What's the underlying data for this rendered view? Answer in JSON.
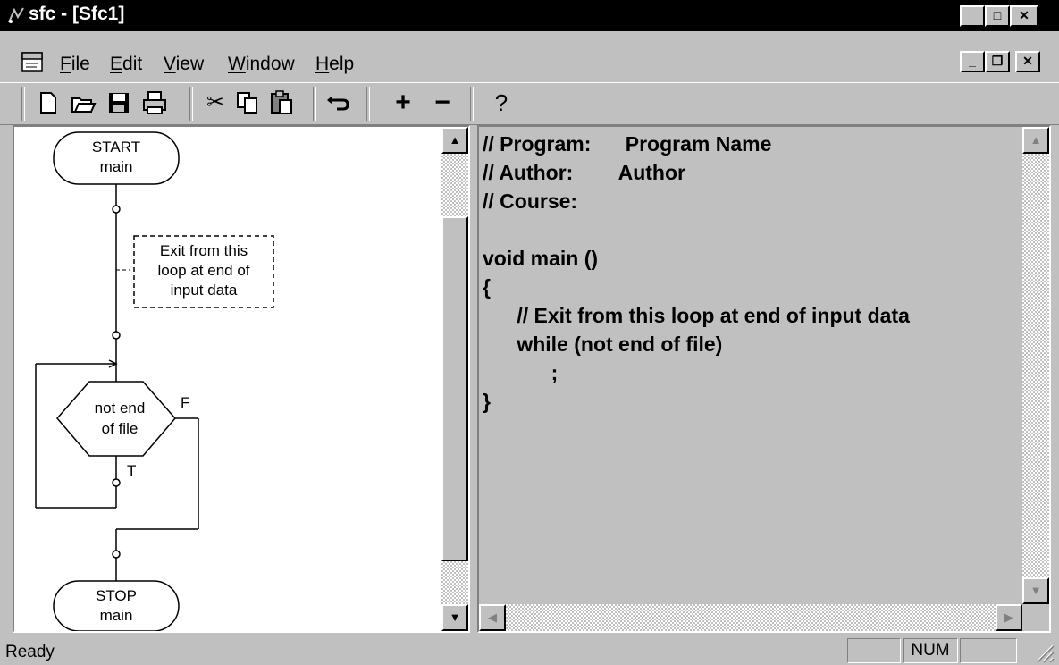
{
  "window": {
    "title": "sfc - [Sfc1]"
  },
  "menu": {
    "items": [
      {
        "label": "File",
        "key": "F",
        "rest": "ile"
      },
      {
        "label": "Edit",
        "key": "E",
        "rest": "dit"
      },
      {
        "label": "View",
        "key": "V",
        "rest": "iew"
      },
      {
        "label": "Window",
        "key": "W",
        "rest": "indow"
      },
      {
        "label": "Help",
        "key": "H",
        "rest": "elp"
      }
    ]
  },
  "toolbar": {
    "icons": [
      "new-file-icon",
      "open-folder-icon",
      "save-icon",
      "print-icon",
      "cut-icon",
      "copy-icon",
      "paste-icon",
      "undo-icon",
      "plus-icon",
      "minus-icon",
      "help-icon"
    ]
  },
  "flowchart": {
    "start_line1": "START",
    "start_line2": "main",
    "comment_line1": "Exit from this",
    "comment_line2": "loop at end of",
    "comment_line3": "input data",
    "decision_line1": "not end",
    "decision_line2": "of file",
    "false_label": "F",
    "true_label": "T",
    "stop_line1": "STOP",
    "stop_line2": "main"
  },
  "code": {
    "lines": [
      "// Program:      Program Name",
      "// Author:        Author",
      "// Course:",
      "",
      "void main ()",
      "{",
      "      // Exit from this loop at end of input data",
      "      while (not end of file)",
      "            ;",
      "}"
    ]
  },
  "status": {
    "text": "Ready",
    "num_indicator": "NUM"
  }
}
